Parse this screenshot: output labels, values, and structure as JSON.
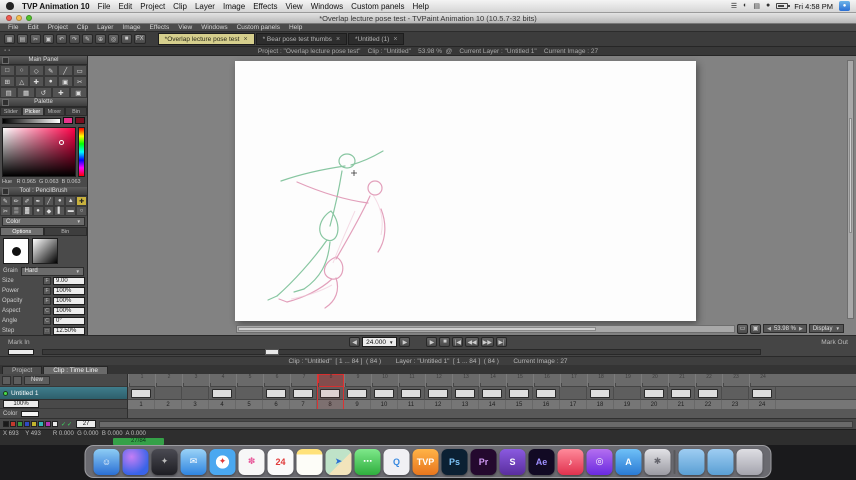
{
  "glyphs": {
    "caret": "▼",
    "left_arrow": "◀",
    "right_arrow": "▶"
  },
  "menubar": {
    "app_name": "TVP Animation 10",
    "menus": [
      "File",
      "Edit",
      "Project",
      "Clip",
      "Layer",
      "Image",
      "Effects",
      "View",
      "Windows",
      "Custom panels",
      "Help"
    ],
    "status_icons": [
      "☰",
      "◐",
      "▤",
      "●"
    ],
    "clock": "Fri 4:58 PM",
    "user_glyph": "●"
  },
  "titlebar": {
    "title": "*Overlap lecture pose test - TVPaint Animation 10 (10.5.7-32 bits)"
  },
  "app_menu": [
    "File",
    "Edit",
    "Project",
    "Clip",
    "Layer",
    "Image",
    "Effects",
    "View",
    "Windows",
    "Custom panels",
    "Help"
  ],
  "toolbar": {
    "buttons": [
      "▦",
      "▤",
      "✂",
      "▣",
      "↶",
      "↷",
      "✎",
      "⊕",
      "◎",
      "■",
      "FX"
    ],
    "tabs": [
      {
        "label": "*Overlap lecture pose test",
        "cls": "doc-tab active"
      },
      {
        "label": "* Bear pose test thumbs",
        "cls": "doc-tab"
      },
      {
        "label": "*Untitled (1)",
        "cls": "doc-tab"
      }
    ],
    "close_glyph": "×"
  },
  "infobar": {
    "icons": [
      "▪",
      "▪"
    ],
    "text": "Project : \"Overlap lecture pose test\"    Clip : \"Untitled\"    53.98 %  @    Current Layer : \"Untitled 1\"    Current Image : 27"
  },
  "left_panel": {
    "main_panel_title": "Main Panel",
    "tools": [
      "□",
      "○",
      "◇",
      "✎",
      "╱",
      "▭",
      "⊞",
      "△",
      "✚",
      "●",
      "▣",
      "✂"
    ],
    "actions": [
      "▤",
      "▦",
      "↺",
      "✚",
      "▣"
    ],
    "palette_title": "Palette",
    "palette_tabs": [
      {
        "label": "Slider",
        "cls": "ptab"
      },
      {
        "label": "Picker",
        "cls": "ptab active"
      },
      {
        "label": "Mixer",
        "cls": "ptab"
      },
      {
        "label": "Bin",
        "cls": "ptab"
      }
    ],
    "fg_swatch_style": "background:#e8348c",
    "bg_swatch_style": "background:#7a1020",
    "hue_readout": "Hue   R 0.965  G 0.063  B 0.063",
    "tool_title": "Tool : PencilBrush",
    "brushes": [
      "✎",
      "✏",
      "✐",
      "✒",
      "╱",
      "●",
      "▲",
      "✚"
    ],
    "brushes2": [
      "✂",
      "▒",
      "▓",
      "●",
      "◆",
      "▌",
      "▬",
      "○"
    ],
    "color_mode": "Color",
    "options_tabs": [
      {
        "label": "Options",
        "cls": "ptab active"
      },
      {
        "label": "Bin",
        "cls": "ptab"
      }
    ],
    "grain_label": "Grain",
    "grain_value": "Hard",
    "params": [
      {
        "label": "Size",
        "flag": "F",
        "value": "9.00"
      },
      {
        "label": "Power",
        "flag": "F",
        "value": "100%"
      },
      {
        "label": "Opacity",
        "flag": "F",
        "value": "100%"
      },
      {
        "label": "Aspect",
        "flag": "C",
        "value": "100%"
      },
      {
        "label": "Angle",
        "flag": "C",
        "value": "0°"
      },
      {
        "label": "Step",
        "flag": "□",
        "value": "12.50%"
      }
    ]
  },
  "canvas": {
    "colors": {
      "green": "#74bd92",
      "pink": "#e096b4",
      "pink_light": "#efc6d6"
    }
  },
  "playback": {
    "zoom_value": "53.98 %",
    "display_label": "Display",
    "corner_buttons": [
      "▭",
      "▣"
    ],
    "mark_in": "Mark In",
    "mark_out": "Mark Out",
    "frame_value": "24.000",
    "transport": [
      "▶",
      "■",
      "|◀",
      "◀◀",
      "▶▶",
      "▶|"
    ]
  },
  "cliprow": {
    "text": "Clip : \"Untitled\"  [ 1 ... 84 ]  ( 84 )        Layer : \"Untitled 1\"  [ 1 ... 84 ]  ( 84 )        Current Image : 27"
  },
  "timeline": {
    "panel_tabs": [
      {
        "label": "Project",
        "cls": "tltab"
      },
      {
        "label": "Clip : Time Line",
        "cls": "tltab active"
      }
    ],
    "new_button": "New",
    "layer": {
      "name": "Untitled 1",
      "opacity": "100%",
      "mode_label": "Color"
    },
    "frames": [
      {
        "n": "1",
        "cls": "cell key",
        "rcls": "rcell"
      },
      {
        "n": "2",
        "cls": "cell",
        "rcls": "rcell"
      },
      {
        "n": "3",
        "cls": "cell",
        "rcls": "rcell"
      },
      {
        "n": "4",
        "cls": "cell key",
        "rcls": "rcell"
      },
      {
        "n": "5",
        "cls": "cell",
        "rcls": "rcell"
      },
      {
        "n": "6",
        "cls": "cell key",
        "rcls": "rcell"
      },
      {
        "n": "7",
        "cls": "cell key",
        "rcls": "rcell"
      },
      {
        "n": "8",
        "cls": "cell key current",
        "rcls": "rcell current"
      },
      {
        "n": "9",
        "cls": "cell key",
        "rcls": "rcell"
      },
      {
        "n": "10",
        "cls": "cell key",
        "rcls": "rcell"
      },
      {
        "n": "11",
        "cls": "cell key",
        "rcls": "rcell"
      },
      {
        "n": "12",
        "cls": "cell key",
        "rcls": "rcell"
      },
      {
        "n": "13",
        "cls": "cell key",
        "rcls": "rcell"
      },
      {
        "n": "14",
        "cls": "cell key",
        "rcls": "rcell"
      },
      {
        "n": "15",
        "cls": "cell key",
        "rcls": "rcell"
      },
      {
        "n": "16",
        "cls": "cell key",
        "rcls": "rcell"
      },
      {
        "n": "17",
        "cls": "cell",
        "rcls": "rcell"
      },
      {
        "n": "18",
        "cls": "cell key",
        "rcls": "rcell"
      },
      {
        "n": "19",
        "cls": "cell",
        "rcls": "rcell"
      },
      {
        "n": "20",
        "cls": "cell key",
        "rcls": "rcell"
      },
      {
        "n": "21",
        "cls": "cell key",
        "rcls": "rcell"
      },
      {
        "n": "22",
        "cls": "cell key",
        "rcls": "rcell"
      },
      {
        "n": "23",
        "cls": "cell",
        "rcls": "rcell"
      },
      {
        "n": "24",
        "cls": "cell key",
        "rcls": "rcell"
      }
    ],
    "swatches": [
      "background:#1a1a1a",
      "background:#c23a2e",
      "background:#3a9a3e",
      "background:#2e4ac2",
      "background:#c2b52e",
      "background:#35b5b5",
      "background:#b535b5",
      "background:#e8e8e8"
    ],
    "checks": "✓✓",
    "frame_field": "27"
  },
  "statusbar": {
    "coords": "X 693    Y 493",
    "rgba": "R 0.000  G 0.000  B 0.000  A 0.000",
    "position": "27/84"
  },
  "dock": {
    "items": [
      {
        "name": "dock-icon-finder",
        "glyph": "☺",
        "style": "background:linear-gradient(180deg,#8ecdf5,#2a6fd4);color:#fff"
      },
      {
        "name": "dock-icon-siri",
        "glyph": "",
        "style": "background:radial-gradient(circle at 35% 30%,#c57ef5,#3a64e8 70%)"
      },
      {
        "name": "dock-icon-launchpad",
        "glyph": "✦",
        "style": "background:linear-gradient(180deg,#4a4a52,#1e1e24);color:#bbb"
      },
      {
        "name": "dock-icon-mail",
        "glyph": "✉",
        "style": "background:linear-gradient(180deg,#9ad2f7,#2f84e0);color:#fff"
      },
      {
        "name": "dock-icon-safari",
        "glyph": "✦",
        "style": "background:radial-gradient(circle,#ffffff 35%,#4aa8f0 37%);color:#e03a3a"
      },
      {
        "name": "dock-icon-photos",
        "glyph": "✽",
        "style": "background:#f7f7f7;color:#e8589a"
      },
      {
        "name": "dock-icon-calendar",
        "glyph": "24",
        "style": "background:#fafafa;color:#e03a3a"
      },
      {
        "name": "dock-icon-notes",
        "glyph": "",
        "style": "background:linear-gradient(180deg,#ffe27a 22%,#fdfdf8 22%)"
      },
      {
        "name": "dock-icon-maps",
        "glyph": "➤",
        "style": "background:linear-gradient(135deg,#bfe3c8 55%,#f2e4bb 55%);color:#2a6fd4"
      },
      {
        "name": "dock-icon-messages",
        "glyph": "⋯",
        "style": "background:linear-gradient(180deg,#7ee88a,#2fae3e);color:#fff"
      },
      {
        "name": "dock-icon-quicktime",
        "glyph": "Q",
        "style": "background:#f0f0f4;color:#3a8ae0"
      },
      {
        "name": "dock-icon-tvpaint",
        "glyph": "TVP",
        "style": "background:linear-gradient(180deg,#ffb347,#e8761e);color:#fff;font-size:6px"
      },
      {
        "name": "dock-icon-photoshop",
        "glyph": "Ps",
        "style": "background:#0b2033;color:#7ec3f7"
      },
      {
        "name": "dock-icon-premiere",
        "glyph": "Pr",
        "style": "background:#24092e;color:#d29af5"
      },
      {
        "name": "dock-icon-skype",
        "glyph": "S",
        "style": "background:linear-gradient(180deg,#8a5ae0,#5a2e9e);color:#fff"
      },
      {
        "name": "dock-icon-after-effects",
        "glyph": "Ae",
        "style": "background:#120a24;color:#9f8fff"
      },
      {
        "name": "dock-icon-music",
        "glyph": "♪",
        "style": "background:linear-gradient(180deg,#ff8a9a,#e0314e);color:#fff"
      },
      {
        "name": "dock-icon-podcasts",
        "glyph": "◎",
        "style": "background:linear-gradient(180deg,#b46ef0,#6a2ae0);color:#fff"
      },
      {
        "name": "dock-icon-app-store",
        "glyph": "A",
        "style": "background:linear-gradient(180deg,#6fc0f7,#2a7ad4);color:#fff"
      },
      {
        "name": "dock-icon-system-preferences",
        "glyph": "✱",
        "style": "background:linear-gradient(180deg,#e2e2e6,#9a9aa2);color:#66666e"
      },
      {
        "name": "dock-separator",
        "glyph": "",
        "style": "width:2px;height:24px;background:rgba(70,70,70,0.5);border-radius:1px;box-shadow:none"
      },
      {
        "name": "dock-icon-folder-documents",
        "glyph": "",
        "style": "background:linear-gradient(180deg,#9ecdf2,#5a9fd4)"
      },
      {
        "name": "dock-icon-folder-downloads",
        "glyph": "",
        "style": "background:linear-gradient(180deg,#9ecdf2,#5a9fd4)"
      },
      {
        "name": "dock-icon-trash",
        "glyph": "",
        "style": "background:linear-gradient(180deg,rgba(235,235,240,0.9),rgba(170,170,180,0.9))"
      }
    ]
  }
}
